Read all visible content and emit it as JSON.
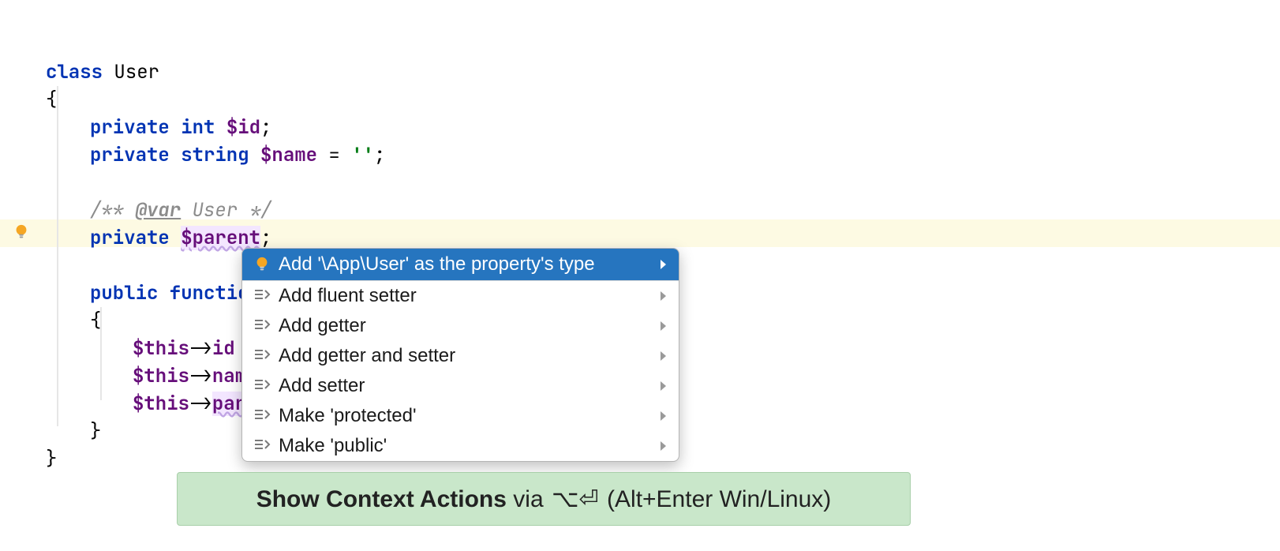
{
  "code": {
    "class_kw": "class",
    "class_name": " User",
    "open_brace": "{",
    "private_kw": "private",
    "int_kw": " int ",
    "string_kw": " string ",
    "id_var": "$id",
    "name_var": "$name",
    "eq": " = ",
    "empty_str": "''",
    "semi": ";",
    "doc_open": "/** ",
    "doc_tag": "@var",
    "doc_rest": " User */",
    "parent_var": "$parent",
    "public_kw": "public",
    "function_kw": " functio",
    "this_var": "$this",
    "arrow": "->",
    "id_ref": "id",
    "name_ref": "nam",
    "par_ref": "par",
    "close_brace": "}"
  },
  "popup": {
    "item0": "Add '\\App\\User' as the property's type",
    "item1": "Add fluent setter",
    "item2": "Add getter",
    "item3": "Add getter and setter",
    "item4": "Add setter",
    "item5": "Make 'protected'",
    "item6": "Make 'public'"
  },
  "banner": {
    "strong": "Show Context Actions",
    "via": " via ",
    "mac_keys": "⌥⏎",
    "tail": " (Alt+Enter Win/Linux)"
  }
}
